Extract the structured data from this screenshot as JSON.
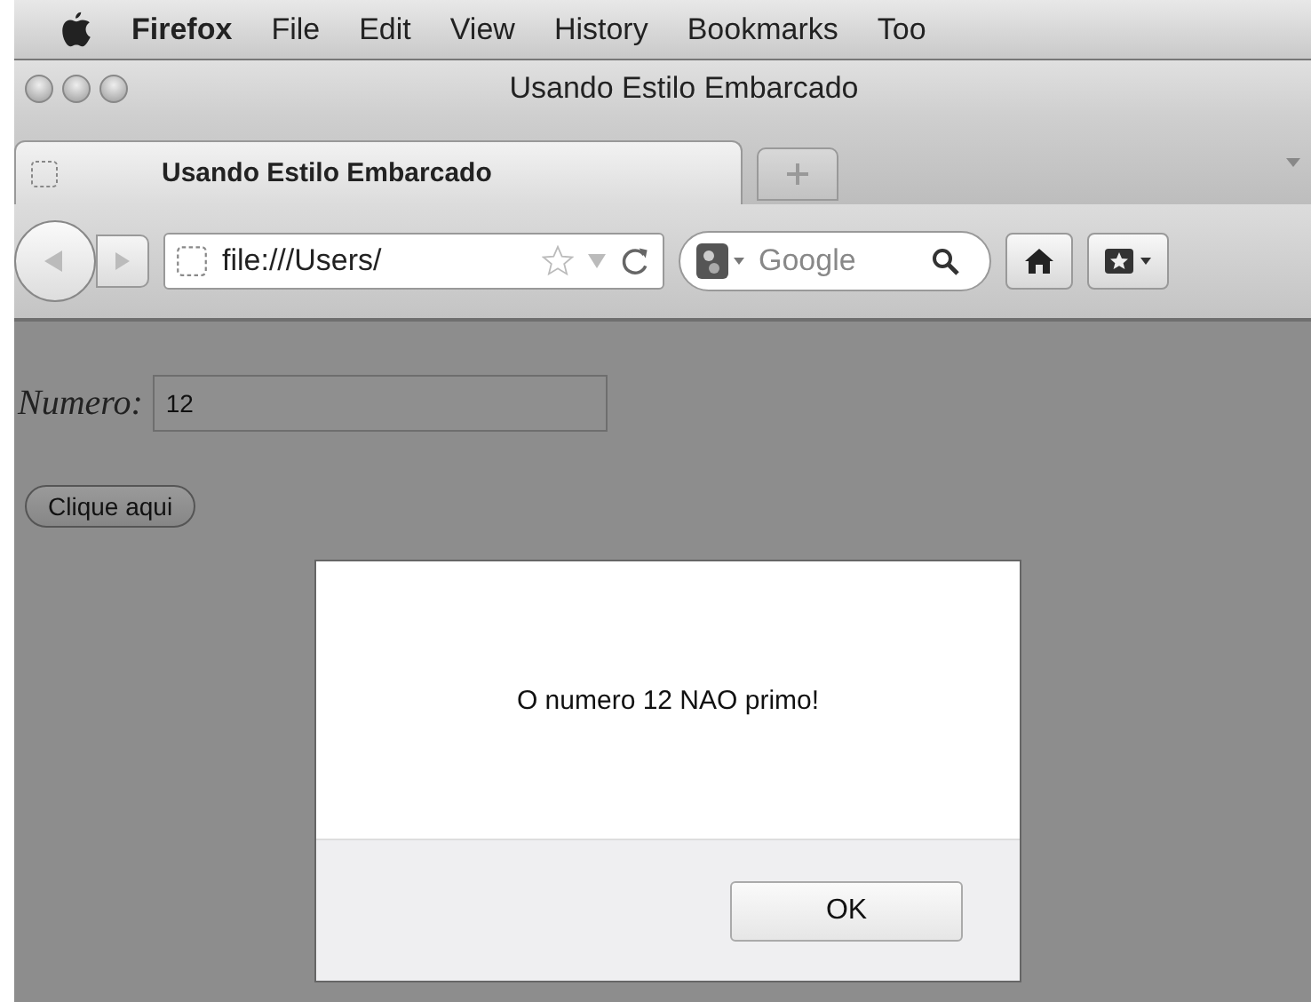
{
  "menu_bar": {
    "items": [
      "Firefox",
      "File",
      "Edit",
      "View",
      "History",
      "Bookmarks",
      "Too"
    ]
  },
  "window": {
    "title": "Usando Estilo Embarcado"
  },
  "tabs": [
    {
      "label": "Usando Estilo Embarcado",
      "selected": true
    }
  ],
  "address_bar": {
    "value": "file:///Users/"
  },
  "search": {
    "placeholder": "Google"
  },
  "page": {
    "field_label": "Numero:",
    "field_value": "12",
    "button": "Clique aqui"
  },
  "alert": {
    "message": "O numero 12 NAO primo!",
    "button": "OK"
  }
}
